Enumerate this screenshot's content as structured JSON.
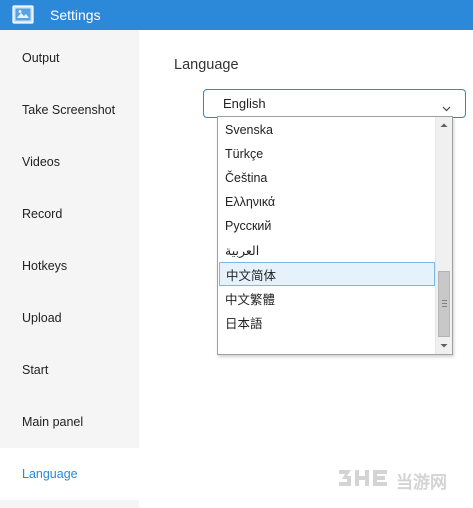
{
  "window": {
    "title": "Settings",
    "accent_color": "#2c88d9",
    "icon": "settings-app-icon"
  },
  "sidebar": {
    "items": [
      {
        "label": "Output",
        "active": false
      },
      {
        "label": "Take Screenshot",
        "active": false
      },
      {
        "label": "Videos",
        "active": false
      },
      {
        "label": "Record",
        "active": false
      },
      {
        "label": "Hotkeys",
        "active": false
      },
      {
        "label": "Upload",
        "active": false
      },
      {
        "label": "Start",
        "active": false
      },
      {
        "label": "Main panel",
        "active": false
      },
      {
        "label": "Language",
        "active": true
      }
    ]
  },
  "language_section": {
    "title": "Language",
    "selected_value": "English",
    "dropdown_icon": "chevron-down-icon",
    "options": [
      {
        "label": "Svenska"
      },
      {
        "label": "Türkçe"
      },
      {
        "label": "Čeština"
      },
      {
        "label": "Ελληνικά"
      },
      {
        "label": "Русский"
      },
      {
        "label": "العربية"
      },
      {
        "label": "中文简体",
        "highlighted": true
      },
      {
        "label": "中文繁體"
      },
      {
        "label": "日本語"
      }
    ],
    "scrollbar": {
      "up_icon": "scroll-up-icon",
      "down_icon": "scroll-down-icon"
    }
  },
  "watermark": {
    "logo": "3HE",
    "text": "当游网"
  }
}
